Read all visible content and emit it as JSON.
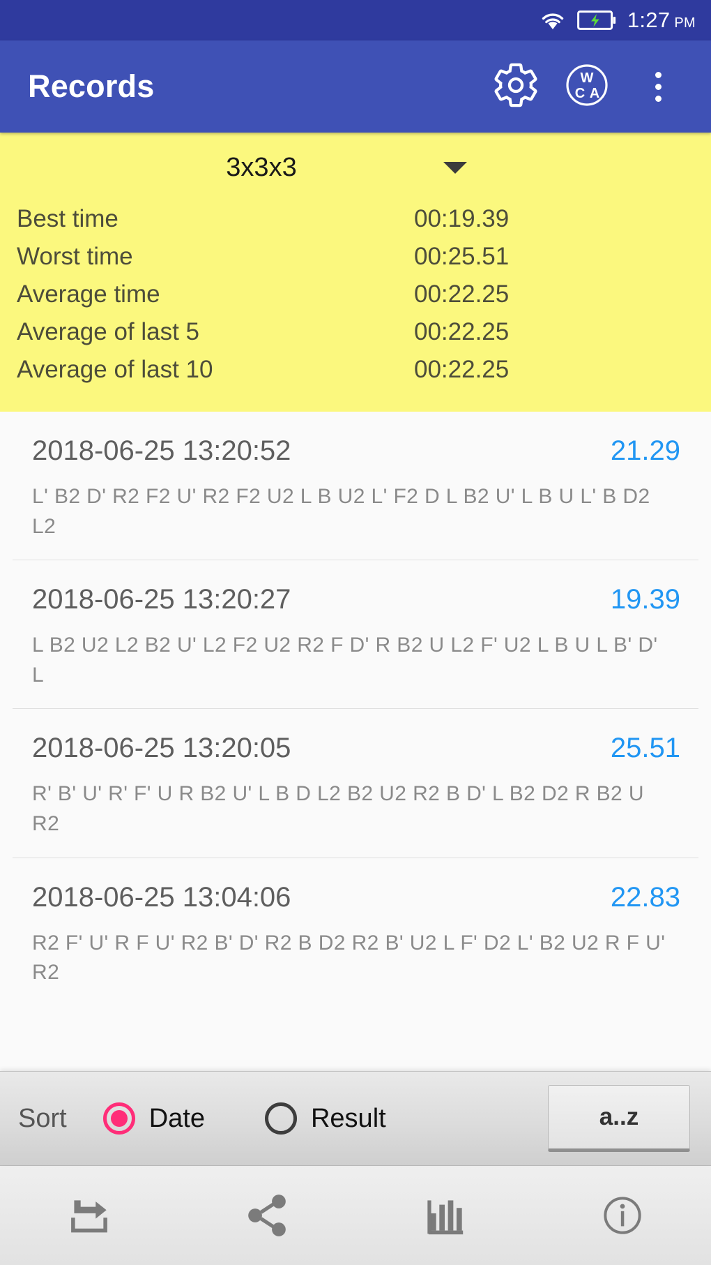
{
  "status_bar": {
    "time": "1:27",
    "ampm": "PM",
    "wifi_icon": "wifi-icon",
    "battery_icon": "battery-charging-icon"
  },
  "app_bar": {
    "title": "Records",
    "settings_icon": "gear-icon",
    "wca_icon": "wca-icon",
    "wca_text_top": "W",
    "wca_text_bottom_left": "C",
    "wca_text_bottom_right": "A",
    "overflow_icon": "overflow-menu-icon"
  },
  "stats": {
    "puzzle": "3x3x3",
    "dropdown_icon": "chevron-down-icon",
    "rows": [
      {
        "label": "Best time",
        "value": "00:19.39"
      },
      {
        "label": "Worst time",
        "value": "00:25.51"
      },
      {
        "label": "Average time",
        "value": "00:22.25"
      },
      {
        "label": "Average of last 5",
        "value": "00:22.25"
      },
      {
        "label": "Average of last 10",
        "value": "00:22.25"
      }
    ]
  },
  "records": [
    {
      "date": "2018-06-25 13:20:52",
      "result": "21.29",
      "scramble": "L' B2 D' R2 F2 U' R2 F2 U2 L B U2 L' F2 D L B2 U' L B U L' B D2 L2"
    },
    {
      "date": "2018-06-25 13:20:27",
      "result": "19.39",
      "scramble": "L B2 U2 L2 B2 U' L2 F2 U2 R2 F D' R B2 U L2 F' U2 L B U L B' D' L"
    },
    {
      "date": "2018-06-25 13:20:05",
      "result": "25.51",
      "scramble": "R' B' U' R' F' U R B2 U' L B D L2 B2 U2 R2 B D' L B2 D2 R B2 U R2"
    },
    {
      "date": "2018-06-25 13:04:06",
      "result": "22.83",
      "scramble": "R2 F' U' R F U' R2 B' D' R2 B D2 R2 B' U2 L F' D2 L' B2 U2 R F U' R2"
    }
  ],
  "sort_bar": {
    "label": "Sort",
    "options": [
      {
        "label": "Date",
        "selected": true
      },
      {
        "label": "Result",
        "selected": false
      }
    ],
    "order_button": "a..z"
  },
  "bottom_bar": {
    "items": [
      {
        "icon": "export-icon"
      },
      {
        "icon": "share-icon"
      },
      {
        "icon": "bar-chart-icon"
      },
      {
        "icon": "info-icon"
      }
    ]
  },
  "colors": {
    "status_bar": "#2f3a9e",
    "app_bar": "#3f51b5",
    "stats_panel": "#fbf87e",
    "result_text": "#2196f3",
    "radio_selected": "#ff2d78"
  }
}
